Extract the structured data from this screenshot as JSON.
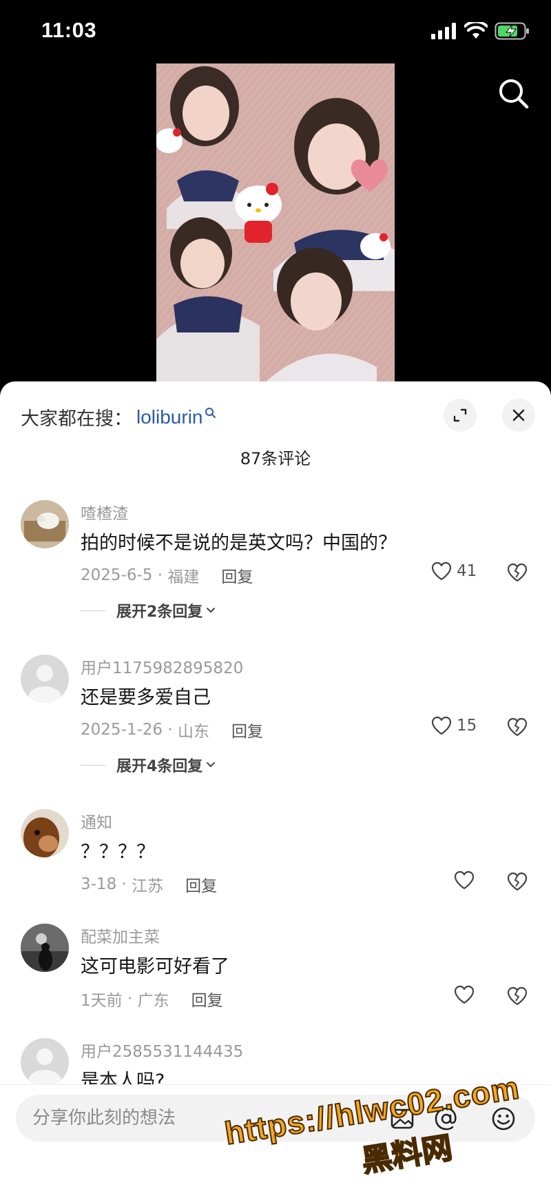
{
  "status_bar": {
    "time": "11:03"
  },
  "hot_search": {
    "prefix": "大家都在搜：",
    "term": "loliburin"
  },
  "comment_count": "87条评论",
  "comments": [
    {
      "user": "喳楂渣",
      "text": "拍的时候不是说的是英文吗？中国的？",
      "date": "2025-6-5",
      "location": "福建",
      "reply": "回复",
      "likes": "41",
      "expand": "展开2条回复"
    },
    {
      "user": "用户1175982895820",
      "text": "还是要多爱自己",
      "date": "2025-1-26",
      "location": "山东",
      "reply": "回复",
      "likes": "15",
      "expand": "展开4条回复"
    },
    {
      "user": "通知",
      "text": "？？？？",
      "date": "3-18",
      "location": "江苏",
      "reply": "回复",
      "likes": ""
    },
    {
      "user": "配菜加主菜",
      "text": "这可电影可好看了",
      "date": "1天前",
      "location": "广东",
      "reply": "回复",
      "likes": ""
    },
    {
      "user": "用户2585531144435",
      "text": "是本人吗?"
    }
  ],
  "input": {
    "placeholder": "分享你此刻的想法"
  },
  "watermark": {
    "url": "https://hlwc02.com",
    "name": "黑料网"
  },
  "colors": {
    "accent_link": "#2a5ba8",
    "watermark": "#f5a623"
  }
}
